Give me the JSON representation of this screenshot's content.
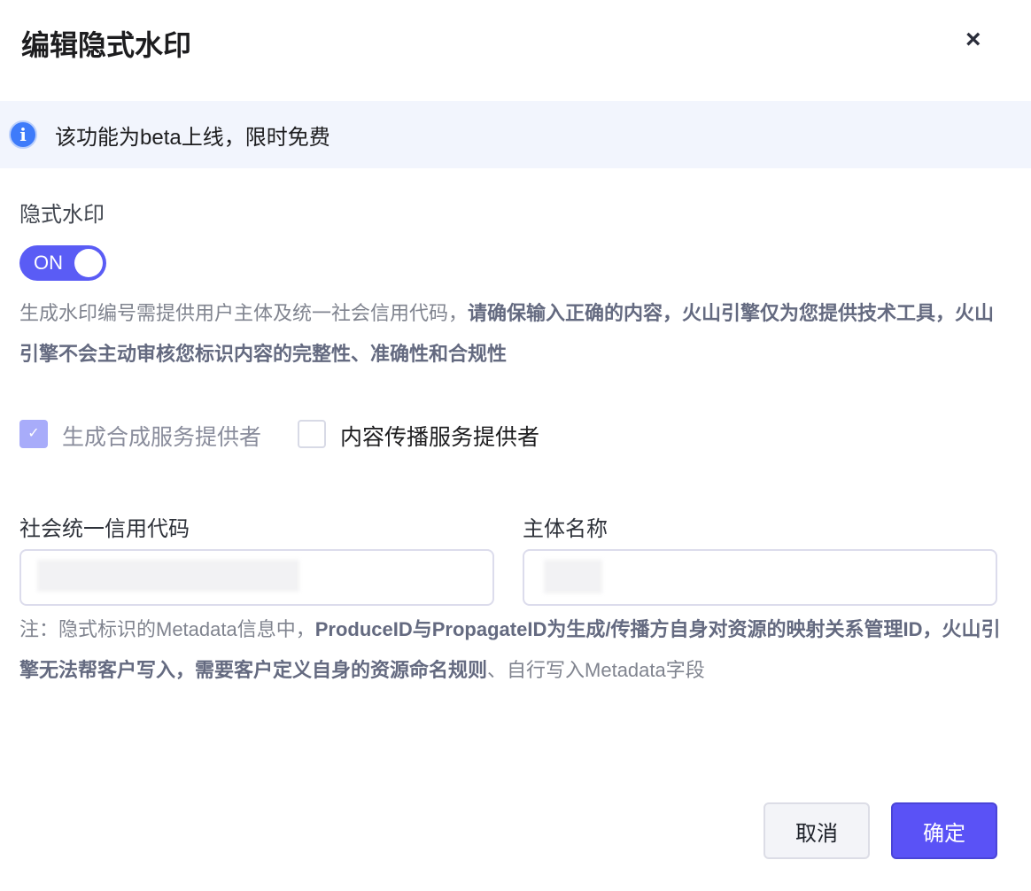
{
  "dialog": {
    "title": "编辑隐式水印",
    "close_icon": "×"
  },
  "banner": {
    "icon": "i",
    "text": "该功能为beta上线，限时免费"
  },
  "watermark": {
    "label": "隐式水印",
    "toggle_label": "ON",
    "toggle_on": true
  },
  "description": {
    "normal": "生成水印编号需提供用户主体及统一社会信用代码，",
    "bold": "请确保输入正确的内容，火山引擎仅为您提供技术工具，火山引擎不会主动审核您标识内容的完整性、准确性和合规性"
  },
  "checkboxes": [
    {
      "label": "生成合成服务提供者",
      "checked": true,
      "disabled": true,
      "check_icon": "✓"
    },
    {
      "label": "内容传播服务提供者",
      "checked": false
    }
  ],
  "fields": {
    "credit_code_label": "社会统一信用代码",
    "entity_name_label": "主体名称"
  },
  "note": {
    "normal1": "注：隐式标识的Metadata信息中，",
    "bold": "ProduceID与PropagateID为生成/传播方自身对资源的映射关系管理ID，火山引擎无法帮客户写入，需要客户定义自身的资源命名规则",
    "normal2": "、自行写入Metadata字段"
  },
  "buttons": {
    "cancel": "取消",
    "confirm": "确定"
  }
}
